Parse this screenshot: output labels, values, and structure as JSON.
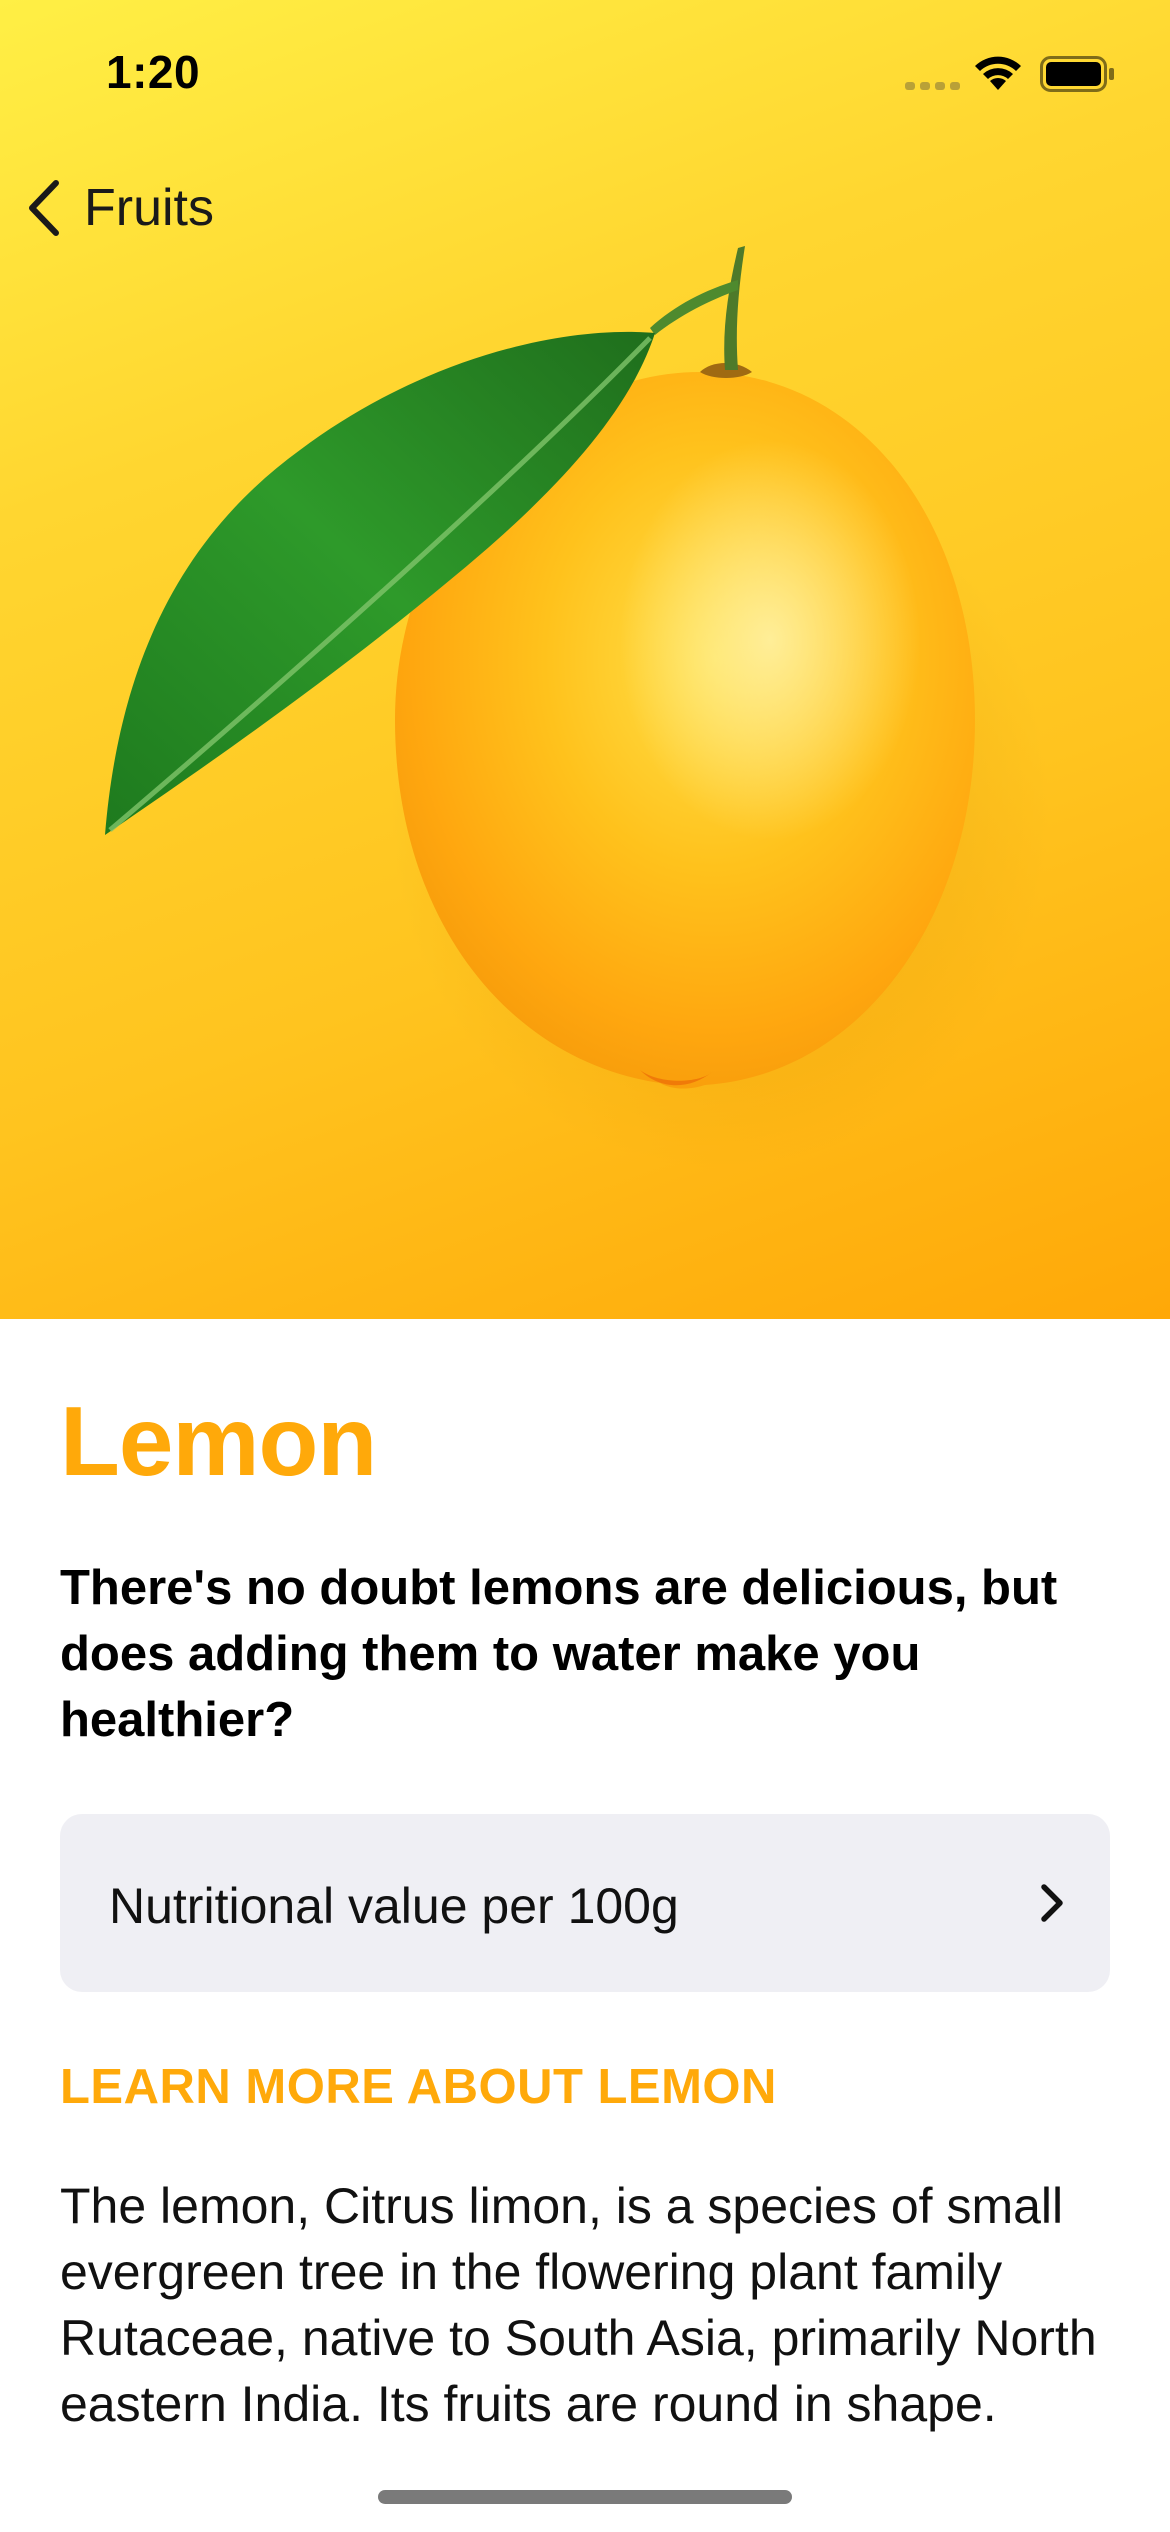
{
  "status_bar": {
    "time": "1:20"
  },
  "nav": {
    "back_label": "Fruits",
    "back_icon": "chevron-left-icon"
  },
  "hero": {
    "image": "lemon-image",
    "gradient_colors": [
      "#FFEF45",
      "#FFD630",
      "#FFC41F",
      "#FFA808"
    ]
  },
  "fruit": {
    "title": "Lemon",
    "headline": "There's no doubt lemons are delicious, but does adding them to water make you healthier?",
    "nutrition_label": "Nutritional value per 100g",
    "section_header": "LEARN MORE ABOUT LEMON",
    "description": "The lemon, Citrus limon, is a species of small evergreen tree in the flowering plant family Rutaceae, native to South Asia, primarily North eastern India. Its fruits are round in shape."
  },
  "colors": {
    "accent": "#FFA90A",
    "row_background": "#EFEFF4"
  }
}
